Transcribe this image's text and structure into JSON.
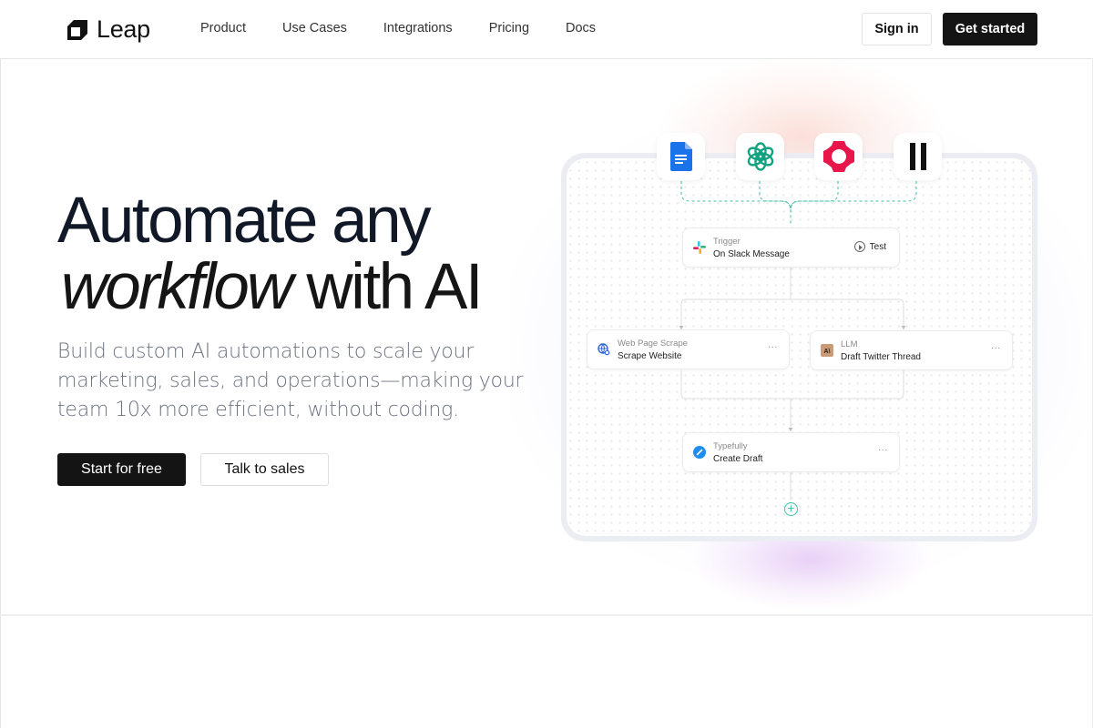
{
  "header": {
    "logo_text": "Leap",
    "nav": [
      "Product",
      "Use Cases",
      "Integrations",
      "Pricing",
      "Docs"
    ],
    "sign_in_label": "Sign in",
    "get_started_label": "Get started"
  },
  "hero": {
    "title_line1": "Automate any",
    "title_italic": "workflow",
    "title_rest": "with AI",
    "subtitle": "Build custom AI automations to scale your marketing, sales, and operations—making your team 10x more efficient, without coding.",
    "primary_cta": "Start for free",
    "secondary_cta": "Talk to sales"
  },
  "workflow": {
    "integrations": [
      {
        "name": "google-docs-icon",
        "color": "#1a73e8"
      },
      {
        "name": "openai-icon",
        "color": "#10a37f"
      },
      {
        "name": "integration-ring-icon",
        "color": "#e8174b"
      },
      {
        "name": "pause-bars-icon",
        "color": "#111111"
      }
    ],
    "accent_color": "#3fbfa3",
    "nodes": {
      "trigger": {
        "label": "Trigger",
        "title": "On Slack Message",
        "action": "Test"
      },
      "scrape": {
        "label": "Web Page Scrape",
        "title": "Scrape Website",
        "more": "···"
      },
      "llm": {
        "label": "LLM",
        "title": "Draft Twitter Thread",
        "more": "···"
      },
      "typefully": {
        "label": "Typefully",
        "title": "Create Draft",
        "more": "···"
      }
    },
    "add_step": "+"
  }
}
